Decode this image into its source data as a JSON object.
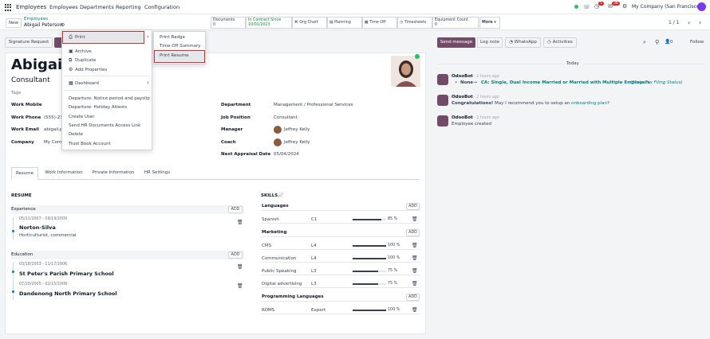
{
  "topbar": {
    "app_name": "Employees",
    "menu": [
      "Employees",
      "Departments",
      "Reporting",
      "Configuration"
    ],
    "notif_count": "5",
    "msg_count": "38",
    "company": "My Company (San Francisco)"
  },
  "control": {
    "new_label": "New",
    "breadcrumb_parent": "Employees",
    "breadcrumb_current": "Abigail Peterson",
    "smart_buttons": [
      {
        "label": "Documents",
        "value": "0"
      },
      {
        "label": "In Contract Since",
        "value": "10/01/2023"
      },
      {
        "label": "Org Chart"
      },
      {
        "label": "Planning"
      },
      {
        "label": "Time Off"
      },
      {
        "label": "Timesheets"
      },
      {
        "label": "Equipment Count",
        "value": "0"
      },
      {
        "label": "More"
      }
    ],
    "pager": "1 / 1"
  },
  "statusbar": {
    "signature_label": "Signature Request"
  },
  "gear_menu": {
    "items": [
      "Print",
      "Archive",
      "Duplicate",
      "Add Properties",
      "Dashboard",
      "Departure: Notice period and payslip",
      "Departure: Holiday Attests",
      "Create User",
      "Send HR Documents Access Link",
      "Delete",
      "Trust Book Account"
    ]
  },
  "print_submenu": {
    "items": [
      "Print Badge",
      "Time Off Summary",
      "Print Resume"
    ]
  },
  "employee": {
    "name": "Abigail P",
    "job_title": "Consultant",
    "tags_label": "Tags",
    "left_fields": [
      {
        "label": "Work Mobile",
        "value": ""
      },
      {
        "label": "Work Phone",
        "value": "(555)-23"
      },
      {
        "label": "Work Email",
        "value": "abigail.p"
      },
      {
        "label": "Company",
        "value": "My Com"
      }
    ],
    "right_fields": [
      {
        "label": "Department",
        "value": "Management / Professional Services"
      },
      {
        "label": "Job Position",
        "value": "Consultant"
      },
      {
        "label": "Manager",
        "value": "Jeffrey Kelly"
      },
      {
        "label": "Coach",
        "value": "Jeffrey Kelly"
      },
      {
        "label": "Next Appraisal Date",
        "value": "05/04/2024"
      }
    ]
  },
  "tabs": [
    "Resume",
    "Work Information",
    "Private Information",
    "HR Settings"
  ],
  "resume": {
    "heading": "RESUME",
    "add_label": "ADD",
    "sections": [
      {
        "title": "Experience",
        "entries": [
          {
            "dates": "05/21/2007 - 09/19/2009",
            "name": "Norton-Silva",
            "desc": "Horticulturist, commercial"
          }
        ]
      },
      {
        "title": "Education",
        "entries": [
          {
            "dates": "03/18/2003 - 11/17/2006",
            "name": "St Peter's Parish Primary School",
            "desc": ""
          },
          {
            "dates": "07/20/2005 - 02/15/2008",
            "name": "Dandenong North Primary School",
            "desc": ""
          }
        ]
      }
    ]
  },
  "skills": {
    "heading": "SKILLS",
    "add_label": "ADD",
    "groups": [
      {
        "title": "Languages",
        "rows": [
          {
            "name": "Spanish",
            "level": "C1",
            "pct_label": "85 %",
            "pct": 85
          }
        ]
      },
      {
        "title": "Marketing",
        "rows": [
          {
            "name": "CMS",
            "level": "L4",
            "pct_label": "100 %",
            "pct": 100
          },
          {
            "name": "Communication",
            "level": "L4",
            "pct_label": "100 %",
            "pct": 100
          },
          {
            "name": "Public Speaking",
            "level": "L3",
            "pct_label": "75 %",
            "pct": 75
          },
          {
            "name": "Digital advertising",
            "level": "L3",
            "pct_label": "75 %",
            "pct": 75
          }
        ]
      },
      {
        "title": "Programming Languages",
        "rows": [
          {
            "name": "RDMS",
            "level": "Expert",
            "pct_label": "100 %",
            "pct": 100
          }
        ]
      }
    ]
  },
  "chatter": {
    "send_label": "Send message",
    "log_label": "Log note",
    "whatsapp_label": "WhatsApp",
    "activities_label": "Activities",
    "follower_count": "0",
    "follow_label": "Follow",
    "day_label": "Today",
    "messages": [
      {
        "author": "OdooBot",
        "time": "- 2 hours ago",
        "field": "None",
        "value": "CA: Single, Dual Income Married or Married with Multiple Employers",
        "field_name": "(State Tax Filing Status)"
      },
      {
        "author": "OdooBot",
        "time": "- 2 hours ago",
        "text_a": "Congratulations!",
        "text_b": " May I recommend you to setup an ",
        "link": "onboarding plan",
        "text_c": "?"
      },
      {
        "author": "OdooBot",
        "time": "- 2 hours ago",
        "text": "Employee created"
      }
    ]
  },
  "colors": {
    "accent": "#714b67",
    "teal": "#017e84",
    "highlight": "#d32f2f"
  }
}
